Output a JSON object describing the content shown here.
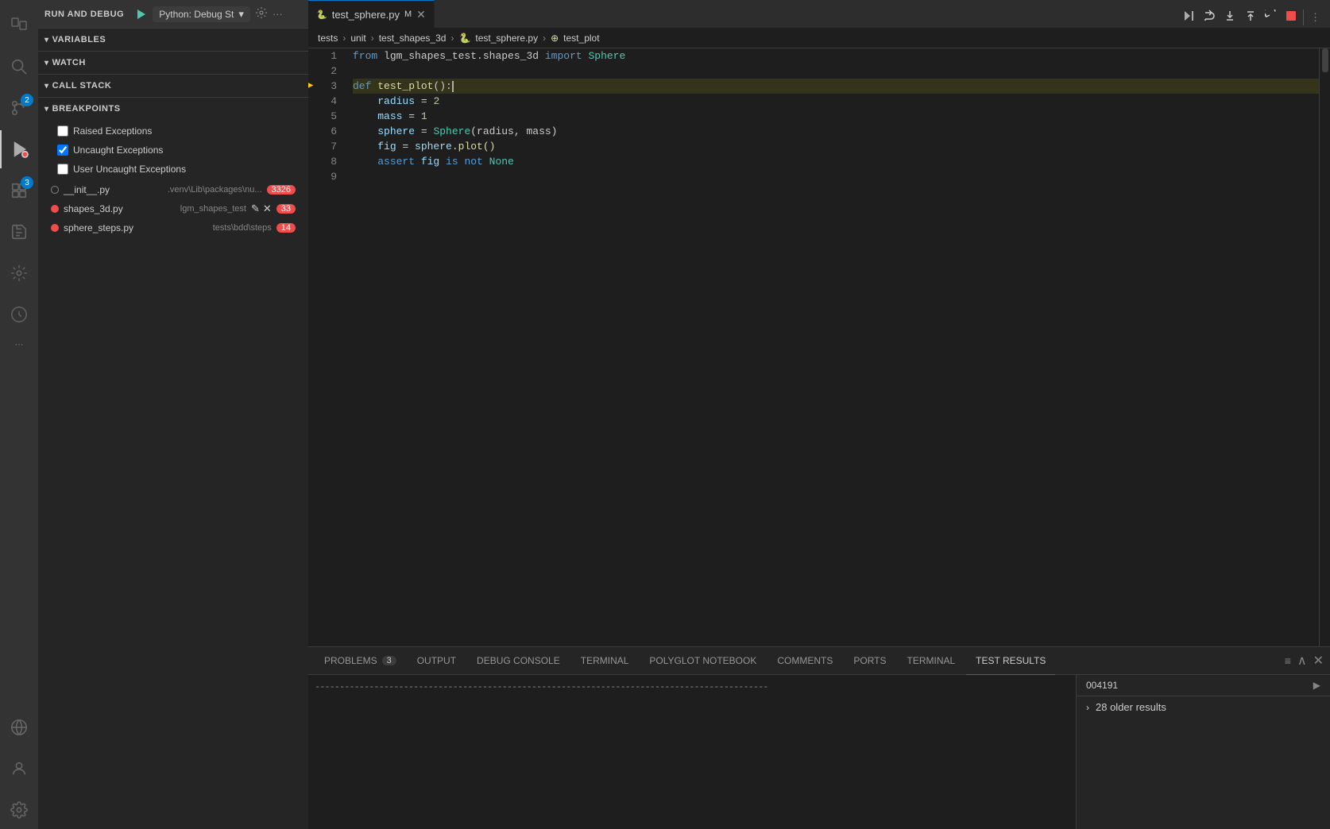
{
  "activityBar": {
    "items": [
      {
        "name": "explorer-icon",
        "icon": "⧉",
        "active": false
      },
      {
        "name": "search-icon",
        "icon": "🔍",
        "active": false
      },
      {
        "name": "source-control-icon",
        "icon": "⎇",
        "active": false,
        "badge": "2"
      },
      {
        "name": "run-debug-icon",
        "icon": "▷",
        "active": true
      },
      {
        "name": "extensions-icon",
        "icon": "⊞",
        "active": false,
        "badge": "3"
      },
      {
        "name": "testing-icon",
        "icon": "⬡",
        "active": false
      }
    ],
    "bottomItems": [
      {
        "name": "remote-icon",
        "icon": "⊗"
      },
      {
        "name": "account-icon",
        "icon": "👤"
      },
      {
        "name": "settings-icon",
        "icon": "⚙"
      },
      {
        "name": "more-icon",
        "icon": "···"
      }
    ]
  },
  "runDebugBar": {
    "title": "RUN AND DEBUG",
    "config": "Python: Debug St",
    "configDropdownIcon": "▾"
  },
  "sidebar": {
    "variables": {
      "label": "VARIABLES"
    },
    "watch": {
      "label": "WATCH"
    },
    "callStack": {
      "label": "CALL STACK"
    },
    "breakpoints": {
      "label": "BREAKPOINTS",
      "items": [
        {
          "label": "Raised Exceptions",
          "checked": false
        },
        {
          "label": "Uncaught Exceptions",
          "checked": true
        },
        {
          "label": "User Uncaught Exceptions",
          "checked": false
        }
      ],
      "files": [
        {
          "name": "__init__.py",
          "path": ".venv\\Lib\\packages\\nu...",
          "count": "3326",
          "dotColor": "empty"
        },
        {
          "name": "shapes_3d.py",
          "path": "lgm_shapes_test",
          "count": "33",
          "dotColor": "red",
          "hasActions": true
        },
        {
          "name": "sphere_steps.py",
          "path": "tests\\bdd\\steps",
          "count": "14",
          "dotColor": "red"
        }
      ]
    }
  },
  "editor": {
    "tab": {
      "label": "test_sphere.py",
      "modified": "M",
      "icon": "🐍"
    },
    "breadcrumb": [
      {
        "label": "tests"
      },
      {
        "label": "unit"
      },
      {
        "label": "test_shapes_3d"
      },
      {
        "label": "test_sphere.py"
      },
      {
        "label": "test_plot"
      }
    ],
    "lines": [
      {
        "num": 1,
        "tokens": [
          {
            "text": "from ",
            "cls": "kw"
          },
          {
            "text": "lgm_shapes_test.shapes_3d ",
            "cls": ""
          },
          {
            "text": "import ",
            "cls": "kw"
          },
          {
            "text": "Sphere",
            "cls": "cls"
          }
        ]
      },
      {
        "num": 2,
        "tokens": []
      },
      {
        "num": 3,
        "tokens": [
          {
            "text": "def ",
            "cls": "kw"
          },
          {
            "text": "test_plot",
            "cls": "fn"
          },
          {
            "text": "():",
            "cls": "op"
          }
        ],
        "cursor": true,
        "breakpoint": true,
        "debugArrow": true
      },
      {
        "num": 4,
        "tokens": [
          {
            "text": "    radius ",
            "cls": ""
          },
          {
            "text": "= ",
            "cls": "op"
          },
          {
            "text": "2",
            "cls": "num"
          }
        ]
      },
      {
        "num": 5,
        "tokens": [
          {
            "text": "    mass ",
            "cls": ""
          },
          {
            "text": "= ",
            "cls": "op"
          },
          {
            "text": "1",
            "cls": "num"
          }
        ]
      },
      {
        "num": 6,
        "tokens": [
          {
            "text": "    sphere ",
            "cls": ""
          },
          {
            "text": "= ",
            "cls": "op"
          },
          {
            "text": "Sphere",
            "cls": "cls"
          },
          {
            "text": "(radius, mass)",
            "cls": ""
          }
        ]
      },
      {
        "num": 7,
        "tokens": [
          {
            "text": "    fig ",
            "cls": ""
          },
          {
            "text": "= ",
            "cls": "op"
          },
          {
            "text": "sphere",
            "cls": "var"
          },
          {
            "text": ".plot()",
            "cls": "fn"
          }
        ]
      },
      {
        "num": 8,
        "tokens": [
          {
            "text": "    ",
            "cls": ""
          },
          {
            "text": "assert ",
            "cls": "kw"
          },
          {
            "text": "fig ",
            "cls": "var"
          },
          {
            "text": "is not ",
            "cls": "kw"
          },
          {
            "text": "None",
            "cls": "cls"
          }
        ]
      },
      {
        "num": 9,
        "tokens": []
      }
    ]
  },
  "bottomPanel": {
    "tabs": [
      {
        "label": "PROBLEMS",
        "badge": "3",
        "active": false
      },
      {
        "label": "OUTPUT",
        "active": false
      },
      {
        "label": "DEBUG CONSOLE",
        "active": false
      },
      {
        "label": "TERMINAL",
        "active": false
      },
      {
        "label": "POLYGLOT NOTEBOOK",
        "active": false
      },
      {
        "label": "COMMENTS",
        "active": false
      },
      {
        "label": "PORTS",
        "active": false
      },
      {
        "label": "TERMINAL",
        "active": false
      },
      {
        "label": "TEST RESULTS",
        "active": true
      }
    ],
    "content": {
      "dashes": "--------------------------------------------------------------------------------------------",
      "testResultsValue": "004191",
      "olderResults": "28 older results"
    }
  },
  "debugToolbar": {
    "buttons": [
      {
        "name": "continue-icon",
        "icon": "▷"
      },
      {
        "name": "step-over-icon",
        "icon": "↷"
      },
      {
        "name": "step-into-icon",
        "icon": "↓"
      },
      {
        "name": "step-out-icon",
        "icon": "↑"
      },
      {
        "name": "restart-icon",
        "icon": "↺"
      },
      {
        "name": "stop-icon",
        "icon": "■"
      }
    ]
  }
}
